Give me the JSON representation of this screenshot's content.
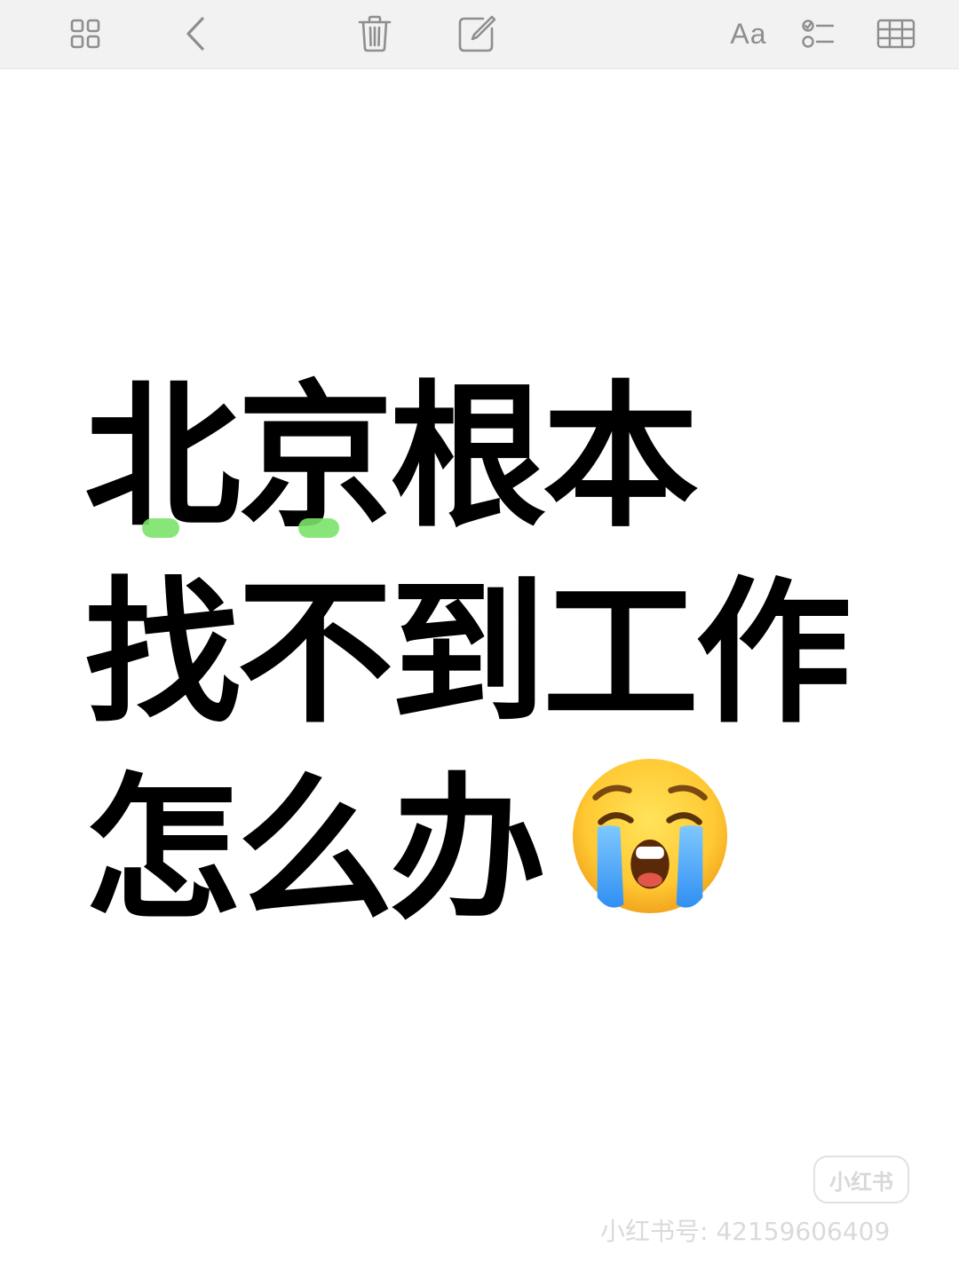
{
  "toolbar": {
    "items": [
      {
        "name": "gallery-grid-icon"
      },
      {
        "name": "back-chevron-icon"
      },
      {
        "name": "trash-icon"
      },
      {
        "name": "compose-icon"
      },
      {
        "name": "format-text",
        "label": "Aa"
      },
      {
        "name": "checklist-icon"
      },
      {
        "name": "table-icon"
      }
    ],
    "icon_color": "#8e8e8e",
    "background": "#f2f2f2"
  },
  "note": {
    "lines": [
      "北京根本",
      "找不到工作",
      "怎么办"
    ],
    "emoji": "loudly-crying-face",
    "highlight_color": "#7be36a"
  },
  "watermark": {
    "logo": "小红书",
    "id_text": "小红书号: 4215960640­9"
  }
}
